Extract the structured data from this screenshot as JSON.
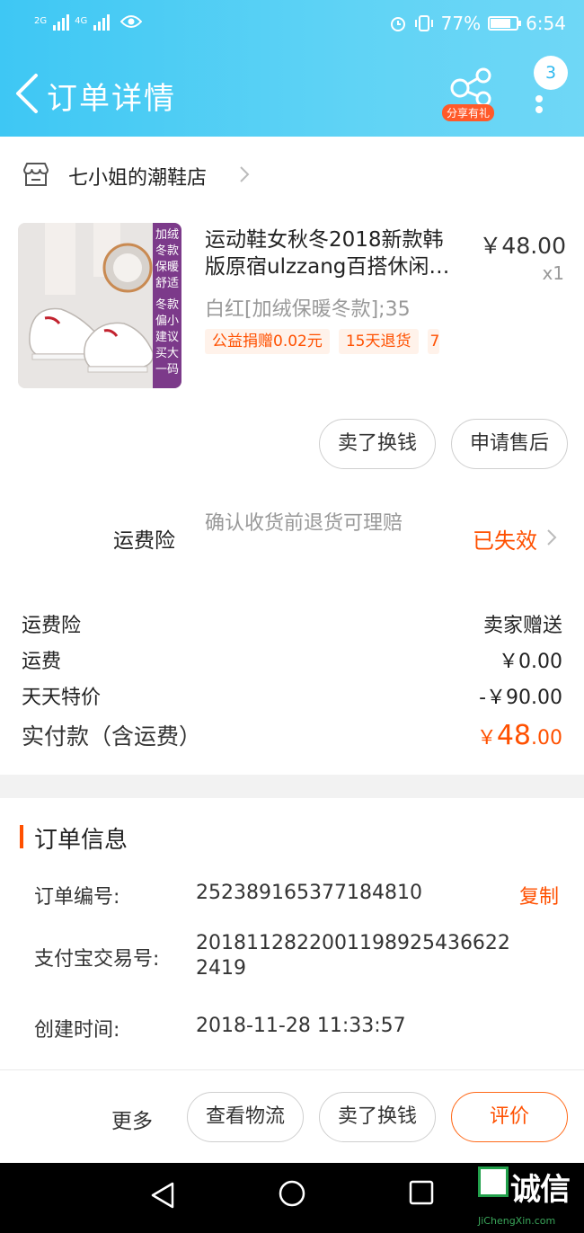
{
  "status_bar": {
    "network_1": "2G",
    "network_2": "4G",
    "battery": "77%",
    "battery_level": 0.77,
    "time": "6:54"
  },
  "header": {
    "title": "订单详情",
    "share_badge": "分享有礼",
    "more_count": "3"
  },
  "shop": {
    "name": "七小姐的潮鞋店"
  },
  "product": {
    "title_line1": "运动鞋女秋冬2018新款韩",
    "title_line2": "版原宿ulzzang百搭休闲…",
    "price": "￥48.00",
    "quantity": "x1",
    "spec": "白红[加绒保暖冬款];35",
    "tags": [
      "公益捐赠0.02元",
      "15天退货",
      "7"
    ],
    "image_text": [
      "加绒",
      "冬款",
      "保暖",
      "舒适",
      "冬款",
      "偏小",
      "建议",
      "买大",
      "一码"
    ]
  },
  "item_actions": {
    "sell_exchange": "卖了换钱",
    "after_sale": "申请售后"
  },
  "insurance": {
    "label": "运费险",
    "desc": "确认收货前退货可理赔",
    "status": "已失效"
  },
  "fees": [
    {
      "label": "运费险",
      "value": "卖家赠送"
    },
    {
      "label": "运费",
      "value": "￥0.00"
    },
    {
      "label": "天天特价",
      "value": "-￥90.00"
    }
  ],
  "total": {
    "label": "实付款（含运费）",
    "currency": "￥",
    "integer": "48",
    "decimal": ".00"
  },
  "order_info": {
    "title": "订单信息",
    "order_no_label": "订单编号:",
    "order_no": "252389165377184810",
    "copy": "复制",
    "alipay_label": "支付宝交易号:",
    "alipay_no_line1": "2018112822001198925436622",
    "alipay_no_line2": "2419",
    "created_label": "创建时间:",
    "created": "2018-11-28 11:33:57"
  },
  "bottom_bar": {
    "more": "更多",
    "logistics": "查看物流",
    "sell_exchange": "卖了换钱",
    "review": "评价"
  },
  "watermark": {
    "text": "诚信",
    "url": "JiChengXin.com"
  },
  "colors": {
    "header": "#3ec7f4",
    "accent": "#ff5000"
  }
}
